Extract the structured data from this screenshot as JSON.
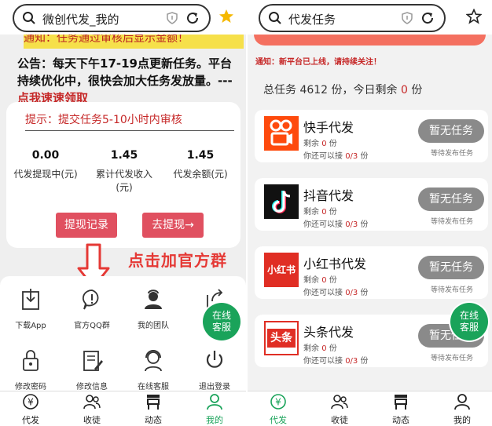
{
  "left": {
    "search": {
      "text": "微创代发_我的"
    },
    "notice_strip": "通知：任务通过审核后显示金额！",
    "announcement": {
      "text": "公告：每天下午17-19点更新任务。平台持续优化中，很快会加大任务发放量。---",
      "link": "点我速速领取"
    },
    "card": {
      "hint": "提示：提交任务5-10小时内审核",
      "stats": [
        {
          "value": "0.00",
          "label": "代发提现中(元)"
        },
        {
          "value": "1.45",
          "label": "累计代发收入(元)"
        },
        {
          "value": "1.45",
          "label": "代发余额(元)"
        }
      ],
      "withdraw_history": "提现记录",
      "withdraw": "去提现→"
    },
    "callout": "点击加官方群",
    "grid": [
      {
        "icon": "download-icon",
        "label": "下载App"
      },
      {
        "icon": "qq-group-icon",
        "label": "官方QQ群"
      },
      {
        "icon": "team-icon",
        "label": "我的团队"
      },
      {
        "icon": "share-icon",
        "label": "邀请"
      },
      {
        "icon": "lock-icon",
        "label": "修改密码"
      },
      {
        "icon": "edit-icon",
        "label": "修改信息"
      },
      {
        "icon": "service-icon",
        "label": "在线客服"
      },
      {
        "icon": "power-icon",
        "label": "退出登录"
      }
    ],
    "online_service": [
      "在线",
      "客服"
    ],
    "tabs": [
      {
        "icon": "yen-icon",
        "label": "代发"
      },
      {
        "icon": "users-icon",
        "label": "收徒"
      },
      {
        "icon": "store-icon",
        "label": "动态"
      },
      {
        "icon": "person-icon",
        "label": "我的"
      }
    ],
    "active_tab": 3
  },
  "right": {
    "search": {
      "text": "代发任务"
    },
    "notice": "通知：新平台已上线，请持续关注！",
    "totals": {
      "prefix": "总任务",
      "total": "4612",
      "mid": "份，今日剩余",
      "remaining": "0",
      "suffix": "份"
    },
    "tasks": [
      {
        "logo": "kuaishou-logo",
        "name": "快手代发",
        "remaining_label": "剩余",
        "remaining": "0",
        "unit": "份",
        "cap_label": "你还可以接",
        "cap": "0/3",
        "button": "暂无任务",
        "wait": "等待发布任务"
      },
      {
        "logo": "douyin-logo",
        "name": "抖音代发",
        "remaining_label": "剩余",
        "remaining": "0",
        "unit": "份",
        "cap_label": "你还可以接",
        "cap": "0/3",
        "button": "暂无任务",
        "wait": "等待发布任务"
      },
      {
        "logo": "xiaohongshu-logo",
        "name": "小红书代发",
        "remaining_label": "剩余",
        "remaining": "0",
        "unit": "份",
        "cap_label": "你还可以接",
        "cap": "0/3",
        "button": "暂无任务",
        "wait": "等待发布任务"
      },
      {
        "logo": "toutiao-logo",
        "name": "头条代发",
        "remaining_label": "剩余",
        "remaining": "0",
        "unit": "份",
        "cap_label": "你还可以接",
        "cap": "0/3",
        "button": "暂无任务",
        "wait": "等待发布任务"
      }
    ],
    "logo_text": {
      "xiaohongshu": "小红书",
      "toutiao": "头条"
    },
    "online_service": [
      "在线",
      "客服"
    ],
    "tabs": [
      {
        "icon": "yen-icon",
        "label": "代发"
      },
      {
        "icon": "users-icon",
        "label": "收徒"
      },
      {
        "icon": "store-icon",
        "label": "动态"
      },
      {
        "icon": "person-icon",
        "label": "我的"
      }
    ],
    "active_tab": 0
  },
  "colors": {
    "accent_green": "#1aa35a",
    "red_button": "#e05060",
    "alert_red": "#c62828",
    "star_gold": "#f5b800"
  }
}
